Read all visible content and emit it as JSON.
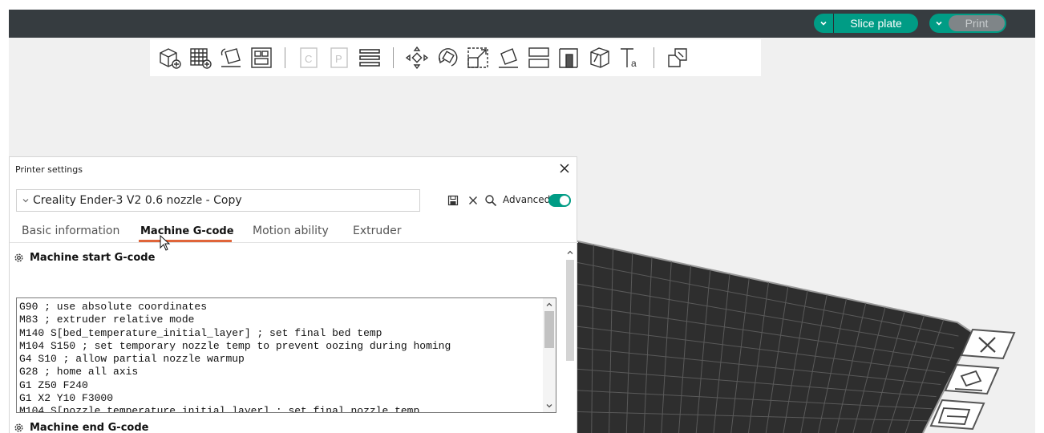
{
  "header": {
    "slice_label": "Slice plate",
    "print_label": "Print"
  },
  "toolbar": {
    "icons": [
      "add-cube-icon",
      "add-plate-icon",
      "auto-orient-icon",
      "arrange-icon",
      "copy-plate-icon",
      "plate-settings-icon",
      "layers-icon",
      "move-icon",
      "rotate-icon",
      "scale-icon",
      "lay-on-face-icon",
      "cut-icon",
      "support-paint-icon",
      "seam-paint-icon",
      "text-icon",
      "assembly-icon"
    ]
  },
  "dialog": {
    "title": "Printer settings",
    "preset": "Creality Ender-3 V2 0.6 nozzle - Copy",
    "advanced_label": "Advanced",
    "tabs": [
      {
        "label": "Basic information"
      },
      {
        "label": "Machine G-code"
      },
      {
        "label": "Motion ability"
      },
      {
        "label": "Extruder"
      }
    ],
    "start_section": "Machine start G-code",
    "end_section": "Machine end G-code",
    "start_gcode": [
      "G90 ; use absolute coordinates",
      "M83 ; extruder relative mode",
      "M140 S[bed_temperature_initial_layer] ; set final bed temp",
      "M104 S150 ; set temporary nozzle temp to prevent oozing during homing",
      "G4 S10 ; allow partial nozzle warmup",
      "G28 ; home all axis",
      "G1 Z50 F240",
      "G1 X2 Y10 F3000",
      "M104 S[nozzle_temperature_initial_layer] ; set final nozzle temp"
    ]
  },
  "colors": {
    "accent": "#009c85",
    "tab_underline": "#e0653a",
    "topbar": "#363c40"
  }
}
